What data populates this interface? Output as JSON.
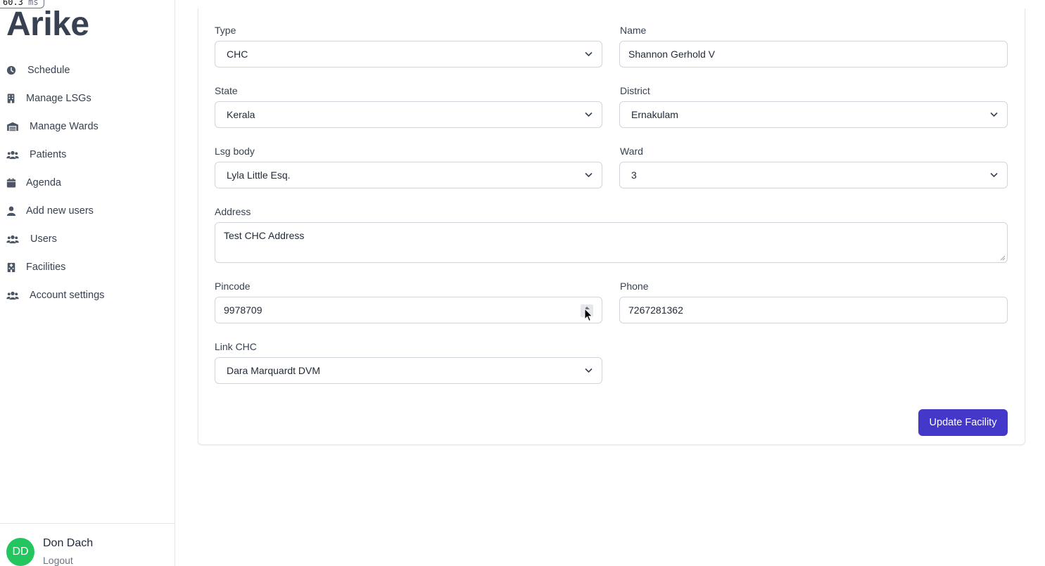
{
  "perf": {
    "value": "60.3",
    "unit": "ms"
  },
  "app": {
    "title": "Arike"
  },
  "sidebar": {
    "items": [
      {
        "label": "Schedule",
        "icon": "clock-icon"
      },
      {
        "label": "Manage LSGs",
        "icon": "building-icon"
      },
      {
        "label": "Manage Wards",
        "icon": "warehouse-icon"
      },
      {
        "label": "Patients",
        "icon": "users-icon"
      },
      {
        "label": "Agenda",
        "icon": "calendar-icon"
      },
      {
        "label": "Add new users",
        "icon": "user-icon"
      },
      {
        "label": "Users",
        "icon": "users-icon"
      },
      {
        "label": "Facilities",
        "icon": "hospital-icon"
      },
      {
        "label": "Account settings",
        "icon": "users-icon"
      }
    ]
  },
  "user": {
    "initials": "DD",
    "name": "Don Dach",
    "logout": "Logout",
    "avatar_color": "#22c55e"
  },
  "form": {
    "type": {
      "label": "Type",
      "value": "CHC"
    },
    "name": {
      "label": "Name",
      "value": "Shannon Gerhold V"
    },
    "state": {
      "label": "State",
      "value": "Kerala"
    },
    "district": {
      "label": "District",
      "value": "Ernakulam"
    },
    "lsg": {
      "label": "Lsg body",
      "value": "Lyla Little Esq."
    },
    "ward": {
      "label": "Ward",
      "value": "3"
    },
    "address": {
      "label": "Address",
      "value": "Test CHC Address"
    },
    "pincode": {
      "label": "Pincode",
      "value": "9978709"
    },
    "phone": {
      "label": "Phone",
      "value": "7267281362"
    },
    "link_chc": {
      "label": "Link CHC",
      "value": "Dara Marquardt DVM"
    },
    "submit": "Update Facility"
  },
  "colors": {
    "accent": "#4338ca",
    "text": "#374151",
    "border": "#d1d5db"
  }
}
